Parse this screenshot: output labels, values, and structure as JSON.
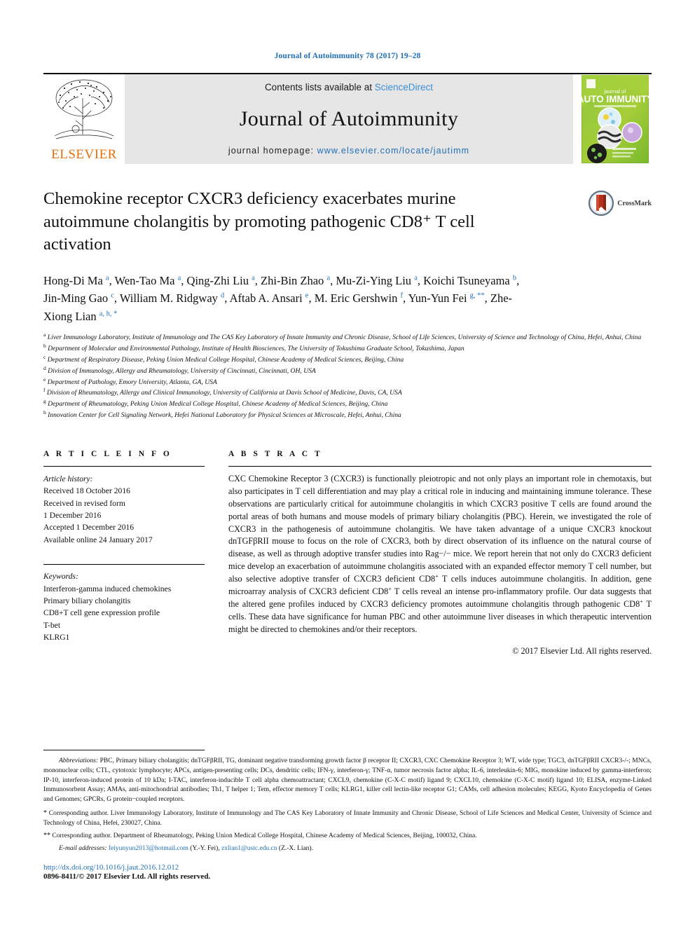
{
  "running_head": "Journal of Autoimmunity 78 (2017) 19–28",
  "masthead": {
    "publisher_name": "ELSEVIER",
    "contents_prefix": "Contents lists available at ",
    "contents_link": "ScienceDirect",
    "journal_name": "Journal of Autoimmunity",
    "homepage_prefix": "journal homepage: ",
    "homepage_url": "www.elsevier.com/locate/jautimm",
    "cover_title_small": "journal of",
    "cover_title_big": "AUTO IMMUNITY"
  },
  "crossmark": {
    "label": "CrossMark"
  },
  "title": "Chemokine receptor CXCR3 deficiency exacerbates murine autoimmune cholangitis by promoting pathogenic CD8⁺ T cell activation",
  "authors_html": "Hong-Di Ma <sup>a</sup>, Wen-Tao Ma <sup>a</sup>, Qing-Zhi Liu <sup>a</sup>, Zhi-Bin Zhao <sup>a</sup>, Mu-Zi-Ying Liu <sup>a</sup>, Koichi Tsuneyama <sup>b</sup>, Jin-Ming Gao <sup>c</sup>, William M. Ridgway <sup>d</sup>, Aftab A. Ansari <sup>e</sup>, M. Eric Gershwin <sup>f</sup>, Yun-Yun Fei <sup>g, **</sup>, Zhe-Xiong Lian <sup>a, h, *</sup>",
  "affiliations": [
    {
      "marker": "a",
      "text": "Liver Immunology Laboratory, Institute of Immunology and The CAS Key Laboratory of Innate Immunity and Chronic Disease, School of Life Sciences, University of Science and Technology of China, Hefei, Anhui, China"
    },
    {
      "marker": "b",
      "text": "Department of Molecular and Environmental Pathology, Institute of Health Biosciences, The University of Tokushima Graduate School, Tokushima, Japan"
    },
    {
      "marker": "c",
      "text": "Department of Respiratory Disease, Peking Union Medical College Hospital, Chinese Academy of Medical Sciences, Beijing, China"
    },
    {
      "marker": "d",
      "text": "Division of Immunology, Allergy and Rheumatology, University of Cincinnati, Cincinnati, OH, USA"
    },
    {
      "marker": "e",
      "text": "Department of Pathology, Emory University, Atlanta, GA, USA"
    },
    {
      "marker": "f",
      "text": "Division of Rheumatology, Allergy and Clinical Immunology, University of California at Davis School of Medicine, Davis, CA, USA"
    },
    {
      "marker": "g",
      "text": "Department of Rheumatology, Peking Union Medical College Hospital, Chinese Academy of Medical Sciences, Beijing, China"
    },
    {
      "marker": "h",
      "text": "Innovation Center for Cell Signaling Network, Hefei National Laboratory for Physical Sciences at Microscale, Hefei, Anhui, China"
    }
  ],
  "article_info": {
    "heading": "A R T I C L E   I N F O",
    "history_label": "Article history:",
    "history_lines": [
      "Received 18 October 2016",
      "Received in revised form",
      "1 December 2016",
      "Accepted 1 December 2016",
      "Available online 24 January 2017"
    ],
    "keywords_label": "Keywords:",
    "keywords": [
      "Interferon-gamma induced chemokines",
      "Primary biliary cholangitis",
      "CD8+T cell gene expression profile",
      "T-bet",
      "KLRG1"
    ]
  },
  "abstract": {
    "heading": "A B S T R A C T",
    "text_html": "CXC Chemokine Receptor 3 (CXCR3) is functionally pleiotropic and not only plays an important role in chemotaxis, but also participates in T cell differentiation and may play a critical role in inducing and maintaining immune tolerance. These observations are particularly critical for autoimmune cholangitis in which CXCR3 positive T cells are found around the portal areas of both humans and mouse models of primary biliary cholangitis (PBC). Herein, we investigated the role of CXCR3 in the pathogenesis of autoimmune cholangitis. We have taken advantage of a unique CXCR3 knockout dnTGFβRII mouse to focus on the role of CXCR3, both by direct observation of its influence on the natural course of disease, as well as through adoptive transfer studies into Rag−/− mice. We report herein that not only do CXCR3 deficient mice develop an exacerbation of autoimmune cholangitis associated with an expanded effector memory T cell number, but also selective adoptive transfer of CXCR3 deficient CD8<sup class=\"sm\">+</sup> T cells induces autoimmune cholangitis. In addition, gene microarray analysis of CXCR3 deficient CD8<sup class=\"sm\">+</sup> T cells reveal an intense pro-inflammatory profile. Our data suggests that the altered gene profiles induced by CXCR3 deficiency promotes autoimmune cholangitis through pathogenic CD8<sup class=\"sm\">+</sup> T cells. These data have significance for human PBC and other autoimmune liver diseases in which therapeutic intervention might be directed to chemokines and/or their receptors.",
    "copyright": "© 2017 Elsevier Ltd. All rights reserved."
  },
  "footnotes": {
    "abbreviations_label": "Abbreviations:",
    "abbreviations_text": "PBC, Primary biliary cholangitis; dnTGFβRII, TG, dominant negative transforming growth factor β receptor II; CXCR3, CXC Chemokine Receptor 3; WT, wide type; TGC3, dnTGFβRII CXCR3-/-; MNCs, mononuclear cells; CTL, cytotoxic lymphocyte; APCs, antigen-presenting cells; DCs, dendritic cells; IFN-γ, interferon-γ; TNF-α, tumor necrosis factor alpha; IL-6, interleukin-6; MIG, monokine induced by gamma-interferon; IP-10, interferon-induced protein of 10 kDa; I-TAC, interferon-inducible T cell alpha chemoattractant; CXCL9, chemokine (C-X-C motif) ligand 9; CXCL10, chemokine (C-X-C motif) ligand 10; ELISA, enzyme-Linked Immunosorbent Assay; AMAs, anti-mitochondrial antibodies; Th1, T helper 1; Tem, effector memory T cells; KLRG1, killer cell lectin-like receptor G1; CAMs, cell adhesion molecules; KEGG, Kyoto Encyclopedia of Genes and Genomes; GPCRs, G protein−coupled receptors.",
    "corresponding_1_marker": "*",
    "corresponding_1": "Corresponding author. Liver Immunology Laboratory, Institute of Immunology and The CAS Key Laboratory of Innate Immunity and Chronic Disease, School of Life Sciences and Medical Center, University of Science and Technology of China, Hefei, 230027, China.",
    "corresponding_2_marker": "**",
    "corresponding_2": "Corresponding author. Department of Rheumatology, Peking Union Medical College Hospital, Chinese Academy of Medical Sciences, Beijing, 100032, China.",
    "email_label": "E-mail addresses:",
    "email_1": "feiyunyun2013@hotmail.com",
    "email_1_attrib": "(Y.-Y. Fei),",
    "email_2": "zxlian1@ustc.edu.cn",
    "email_2_attrib": "(Z.-X. Lian).",
    "doi": "http://dx.doi.org/10.1016/j.jaut.2016.12.012",
    "issn_line": "0896-8411/© 2017 Elsevier Ltd. All rights reserved."
  }
}
